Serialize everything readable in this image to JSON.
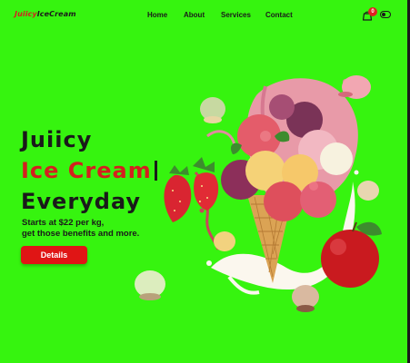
{
  "header": {
    "logo_part1": "Juiicy",
    "logo_part2": "IceCream",
    "nav": [
      {
        "label": "Home"
      },
      {
        "label": "About"
      },
      {
        "label": "Services"
      },
      {
        "label": "Contact"
      }
    ],
    "cart_count": "0",
    "icons": [
      "shopping-bag-icon",
      "theme-toggle-icon"
    ]
  },
  "hero": {
    "line1": "Juiicy",
    "line2": "Ice Cream",
    "line3": "Everyday",
    "subtitle_line1": "Starts at $22 per kg,",
    "subtitle_line2": "get those benefits and more.",
    "cta_label": "Details"
  },
  "colors": {
    "background": "#36f40f",
    "accent_red": "#e01515",
    "text_dark": "#1a1a1a"
  }
}
